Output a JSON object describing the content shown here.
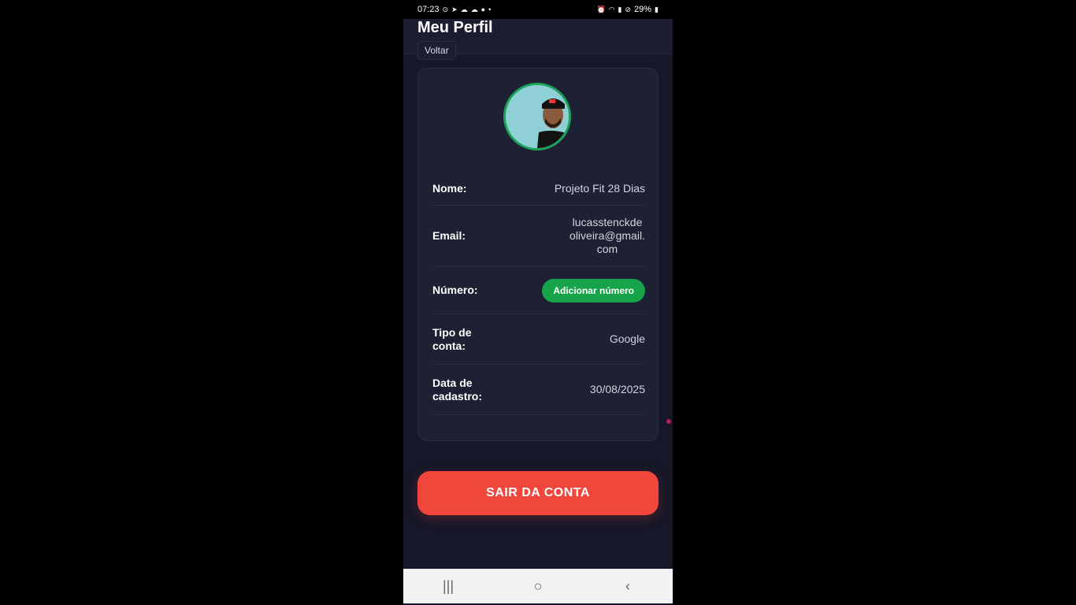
{
  "status_bar": {
    "time": "07:23",
    "battery": "29%",
    "left_icons": [
      "circle-icon",
      "telegram-icon",
      "cloud-icon",
      "cloud-icon",
      "chat-icon",
      "dot-icon"
    ],
    "right_icons": [
      "alarm-icon",
      "wifi-icon",
      "signal-icon",
      "block-icon",
      "battery-icon"
    ]
  },
  "header": {
    "title": "Meu Perfil",
    "back_label": "Voltar"
  },
  "profile": {
    "avatar_icon": "user-avatar",
    "fields": {
      "name_label": "Nome:",
      "name_value": "Projeto Fit 28 Dias",
      "email_label": "Email:",
      "email_value": "lucasstenckdeoliveira@gmail.com",
      "number_label": "Número:",
      "add_number_label": "Adicionar número",
      "account_type_label": "Tipo de conta:",
      "account_type_value": "Google",
      "register_date_label": "Data de cadastro:",
      "register_date_value": "30/08/2025"
    }
  },
  "actions": {
    "logout_label": "SAIR DA CONTA"
  },
  "navbar": {
    "recent_icon": "|||",
    "home_icon": "○",
    "back_icon": "‹"
  },
  "colors": {
    "background": "#161728",
    "card": "#1e2033",
    "accent_green": "#17a34a",
    "logout_red": "#f0463c"
  }
}
